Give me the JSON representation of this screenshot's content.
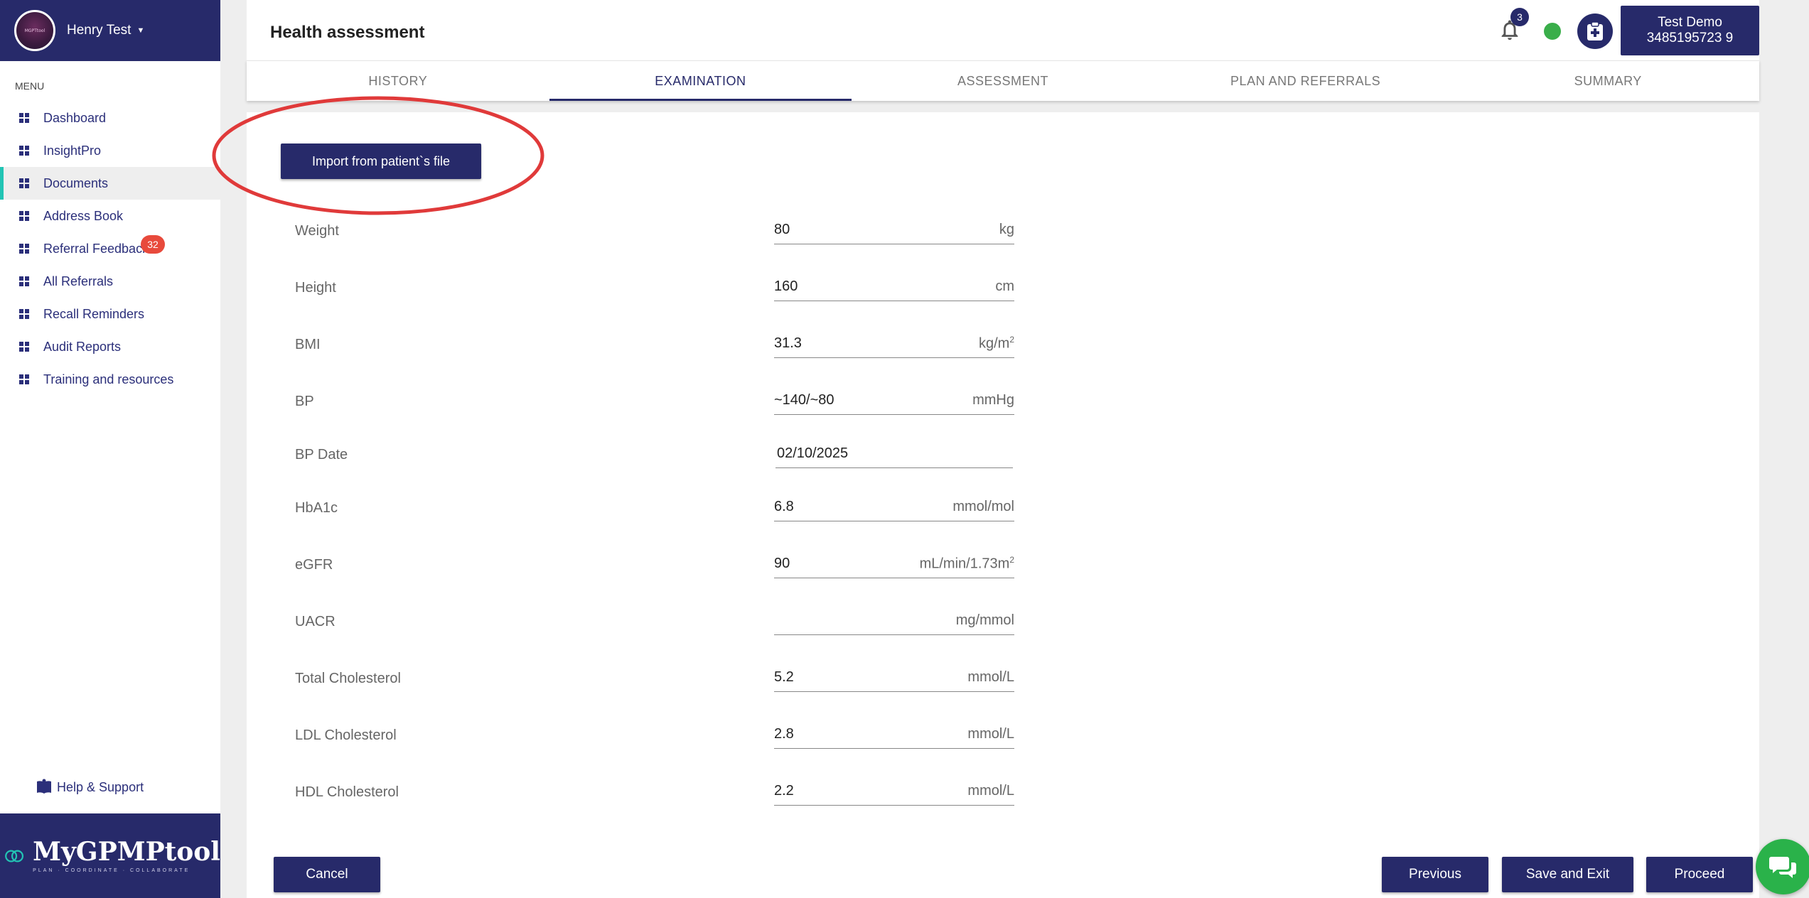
{
  "user": {
    "name": "Henry Test",
    "avatar_text": "MGPTtool"
  },
  "sidebar": {
    "menu_label": "MENU",
    "items": [
      {
        "label": "Dashboard"
      },
      {
        "label": "InsightPro"
      },
      {
        "label": "Documents"
      },
      {
        "label": "Address Book"
      },
      {
        "label": "Referral Feedback",
        "badge": "32"
      },
      {
        "label": "All Referrals"
      },
      {
        "label": "Recall Reminders"
      },
      {
        "label": "Audit Reports"
      },
      {
        "label": "Training and resources"
      }
    ],
    "help_label": "Help & Support"
  },
  "brand": {
    "name": "MyGPMPtool",
    "tagline": "PLAN · COORDINATE · COLLABORATE"
  },
  "header": {
    "title": "Health assessment",
    "notification_count": "3",
    "patient_name": "Test Demo",
    "patient_id": "3485195723 9"
  },
  "tabs": [
    {
      "label": "HISTORY"
    },
    {
      "label": "EXAMINATION"
    },
    {
      "label": "ASSESSMENT"
    },
    {
      "label": "PLAN AND REFERRALS"
    },
    {
      "label": "SUMMARY"
    }
  ],
  "main": {
    "import_label": "Import from patient`s file",
    "fields": {
      "weight": {
        "label": "Weight",
        "value": "80",
        "unit": "kg"
      },
      "height": {
        "label": "Height",
        "value": "160",
        "unit": "cm"
      },
      "bmi": {
        "label": "BMI",
        "value": "31.3",
        "unit": "kg/m",
        "unit_sup": "2"
      },
      "bp": {
        "label": "BP",
        "value": "~140/~80",
        "unit": "mmHg"
      },
      "bp_date": {
        "label": "BP Date",
        "value": "02/10/2025"
      },
      "hba1c": {
        "label": "HbA1c",
        "value": "6.8",
        "unit": "mmol/mol"
      },
      "egfr": {
        "label": "eGFR",
        "value": "90",
        "unit": "mL/min/1.73m",
        "unit_sup": "2"
      },
      "uacr": {
        "label": "UACR",
        "value": "",
        "unit": "mg/mmol"
      },
      "total_chol": {
        "label": "Total Cholesterol",
        "value": "5.2",
        "unit": "mmol/L"
      },
      "ldl": {
        "label": "LDL Cholesterol",
        "value": "2.8",
        "unit": "mmol/L"
      },
      "hdl": {
        "label": "HDL Cholesterol",
        "value": "2.2",
        "unit": "mmol/L"
      }
    }
  },
  "footer": {
    "cancel": "Cancel",
    "previous": "Previous",
    "save_exit": "Save and Exit",
    "proceed": "Proceed"
  },
  "colors": {
    "primary": "#272a6a",
    "accent": "#22c4b4",
    "badge": "#e84a3c",
    "status": "#3aae4a",
    "highlight": "#e03a3a"
  }
}
